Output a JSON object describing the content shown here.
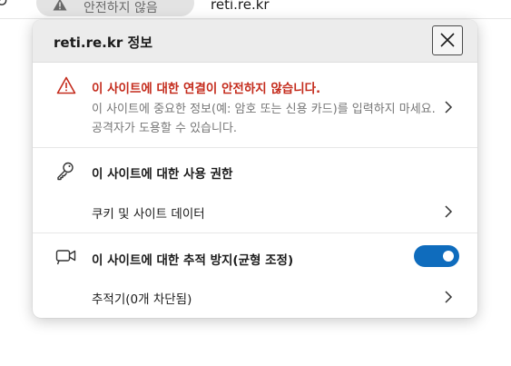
{
  "browser": {
    "security_chip_label": "안전하지 않음",
    "address": "reti.re.kr"
  },
  "flyout": {
    "title": "reti.re.kr 정보",
    "connection": {
      "title": "이 사이트에 대한 연결이 안전하지 않습니다.",
      "description": "이 사이트에 중요한 정보(예: 암호 또는 신용 카드)를 입력하지 마세요. 공격자가 도용할 수 있습니다."
    },
    "permissions": {
      "title": "이 사이트에 대한 사용 권한",
      "cookies_label": "쿠키 및 사이트 데이터"
    },
    "tracking": {
      "title": "이 사이트에 대한 추적 방지(균형 조정)",
      "toggle_on": true,
      "trackers_label": "추적기(0개 차단됨)"
    }
  },
  "colors": {
    "warning_red": "#c42b1c",
    "toggle_blue": "#0f6cbd",
    "header_bg": "#ececec"
  },
  "icons": [
    "reload-icon",
    "warning-icon",
    "close-icon",
    "key-icon",
    "camera-tracking-icon",
    "chevron-right-icon"
  ]
}
